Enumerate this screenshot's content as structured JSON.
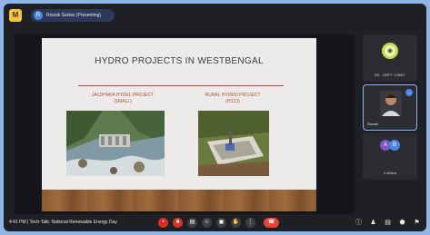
{
  "app": {
    "badge_letter": "M"
  },
  "presenter": {
    "initial": "R",
    "label": "Rousik Sarkar (Presenting)"
  },
  "slide": {
    "title": "HYDRO PROJECTS IN WESTBENGAL",
    "projects": [
      {
        "name": "JALDHAKA HYDEL PROJECT",
        "type": "(SMALL)"
      },
      {
        "name": "RURAL HYDRO PROJECT",
        "type": "(PICO)"
      }
    ]
  },
  "participants": [
    {
      "label": "EE - DEPT. CSMIT",
      "kind": "logo"
    },
    {
      "label": "Rousik",
      "kind": "video",
      "badge": "…"
    },
    {
      "label": "4 others",
      "kind": "avatars",
      "avatars": [
        "A",
        "B"
      ]
    }
  ],
  "meeting": {
    "time": "4:41 PM",
    "separator": "|",
    "name": "Tech-Talk: National Renewable Energy Day"
  },
  "controls": [
    {
      "name": "mic-button",
      "glyph": "•",
      "color": "#d93025"
    },
    {
      "name": "camera-button",
      "glyph": "■",
      "color": "#d93025"
    },
    {
      "name": "captions-button",
      "glyph": "▤",
      "color": "#3c4043"
    },
    {
      "name": "emoji-button",
      "glyph": "☺",
      "color": "#3c4043"
    },
    {
      "name": "present-button",
      "glyph": "▣",
      "color": "#3c4043"
    },
    {
      "name": "raise-hand-button",
      "glyph": "✋",
      "color": "#3c4043"
    },
    {
      "name": "more-button",
      "glyph": "⋮",
      "color": "#3c4043"
    }
  ],
  "end_call_glyph": "☎",
  "right_icons": [
    {
      "name": "info-icon",
      "glyph": "ⓘ"
    },
    {
      "name": "people-icon",
      "glyph": "♟"
    },
    {
      "name": "chat-icon",
      "glyph": "▤"
    },
    {
      "name": "activities-icon",
      "glyph": "⬟"
    },
    {
      "name": "host-controls-icon",
      "glyph": "⚑"
    }
  ]
}
